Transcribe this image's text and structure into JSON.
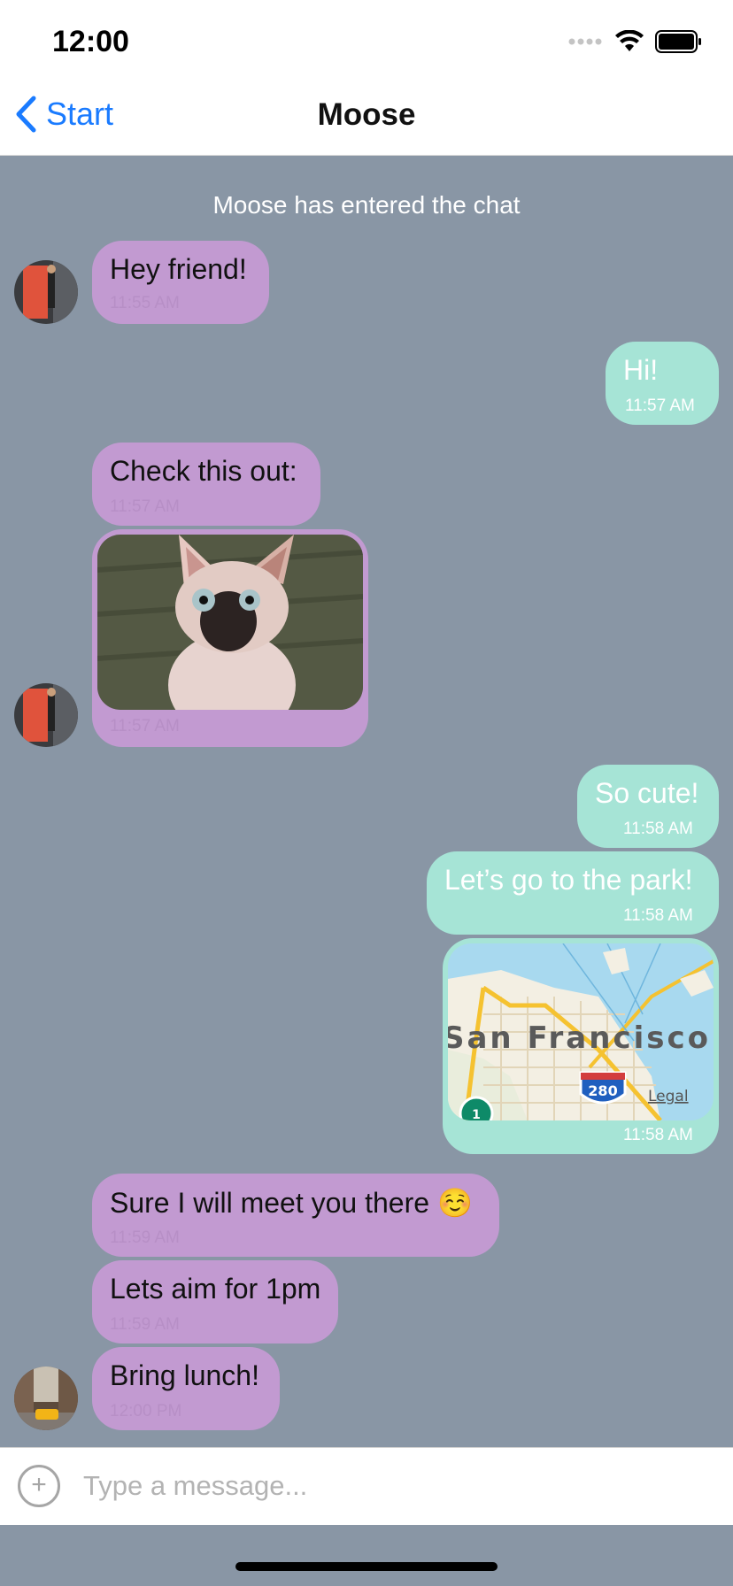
{
  "status_bar": {
    "time": "12:00"
  },
  "nav": {
    "back_label": "Start",
    "title": "Moose"
  },
  "system_message": "Moose has entered the chat",
  "messages": [
    {
      "side": "incoming",
      "text": "Hey friend!",
      "time": "11:55 AM"
    },
    {
      "side": "outgoing",
      "text": "Hi!",
      "time": "11:57 AM"
    },
    {
      "side": "incoming",
      "text": "Check this out:",
      "time": "11:57 AM"
    },
    {
      "side": "incoming",
      "type": "image",
      "image": "hairless-cat-photo",
      "time": "11:57 AM"
    },
    {
      "side": "outgoing",
      "text": "So cute!",
      "time": "11:58 AM"
    },
    {
      "side": "outgoing",
      "text": "Let’s go to the park!",
      "time": "11:58 AM"
    },
    {
      "side": "outgoing",
      "type": "map",
      "map_label": "San Francisco",
      "shield_280": "280",
      "shield_1": "1",
      "legal": "Legal",
      "time": "11:58 AM"
    },
    {
      "side": "incoming",
      "text": "Sure I will meet you there ☺️",
      "time": "11:59 AM"
    },
    {
      "side": "incoming",
      "text": "Lets aim for 1pm",
      "time": "11:59 AM"
    },
    {
      "side": "incoming",
      "text": "Bring lunch!",
      "time": "12:00 PM"
    }
  ],
  "input": {
    "placeholder": "Type a message..."
  },
  "colors": {
    "background": "#8996a5",
    "incoming_bubble": "#c29ad1",
    "outgoing_bubble": "#a6e4d6",
    "accent": "#1a7bff"
  }
}
